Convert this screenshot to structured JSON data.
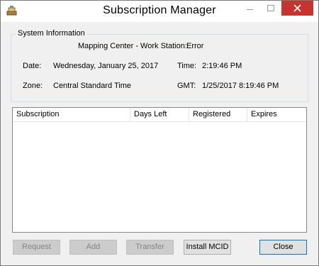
{
  "window": {
    "title": "Subscription Manager"
  },
  "system_info": {
    "legend": "System Information",
    "workstation_label": "Mapping Center - Work Station:",
    "workstation_value": "Error",
    "date_label": "Date:",
    "date_value": "Wednesday, January 25, 2017",
    "time_label": "Time:",
    "time_value": "2:19:46 PM",
    "zone_label": "Zone:",
    "zone_value": "Central Standard Time",
    "gmt_label": "GMT:",
    "gmt_value": "1/25/2017 8:19:46 PM"
  },
  "list": {
    "columns": [
      "Subscription",
      "Days Left",
      "Registered",
      "Expires"
    ],
    "rows": []
  },
  "buttons": {
    "request": "Request",
    "add": "Add",
    "transfer": "Transfer",
    "install": "Install MCID",
    "close": "Close"
  },
  "colors": {
    "close_button_red": "#c7342e",
    "default_button_border": "#0078d7"
  }
}
